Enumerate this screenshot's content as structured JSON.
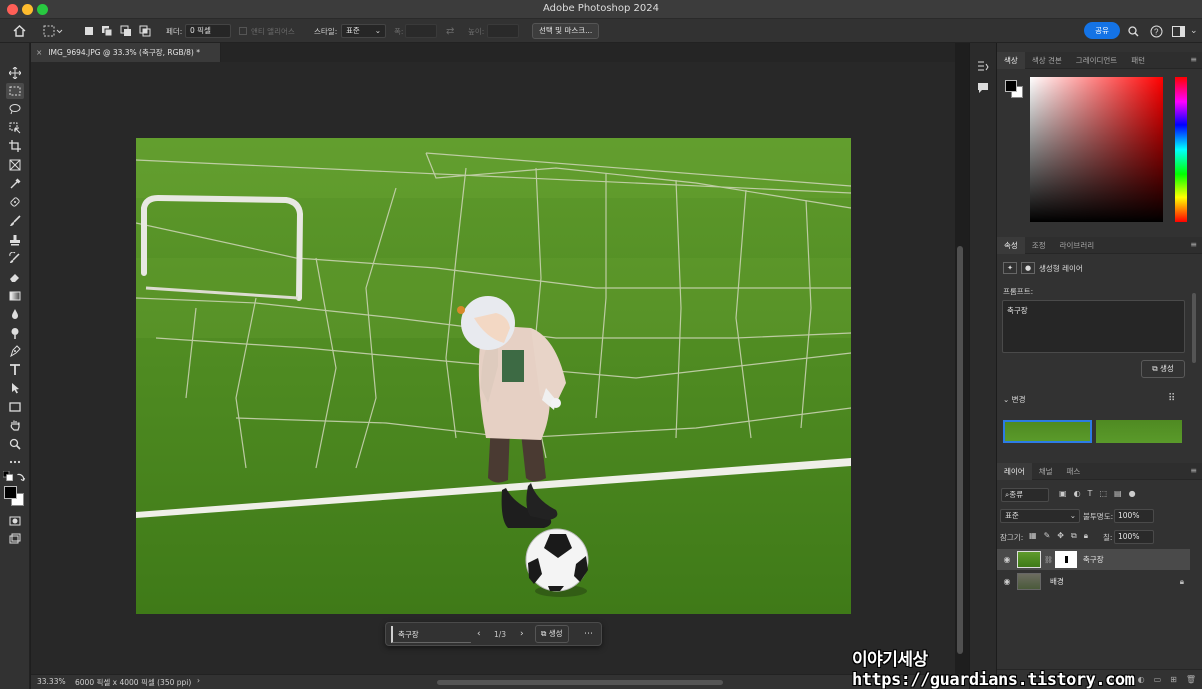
{
  "app": {
    "title": "Adobe Photoshop 2024"
  },
  "options": {
    "feather_label": "페더:",
    "feather_value": "0 픽셀",
    "antialias_label": "앤티 앨리어스",
    "style_label": "스타일:",
    "style_value": "표준",
    "width_label": "폭:",
    "height_label": "높이:",
    "select_mask_label": "선택 및 마스크...",
    "share_label": "공유"
  },
  "document": {
    "tab_title": "IMG_9694.JPG @ 33.3% (축구장, RGB/8) *",
    "zoom": "33.33%",
    "info": "6000 픽셀 x 4000 픽셀 (350 ppi)"
  },
  "contextual_bar": {
    "prompt": "축구장",
    "counter": "1/3",
    "generate_label": "생성"
  },
  "color_panel": {
    "tabs": [
      "색상",
      "색상 견본",
      "그레이디언트",
      "패턴"
    ],
    "foreground": "#000000",
    "background": "#ffffff"
  },
  "properties_panel": {
    "tabs": [
      "속성",
      "조정",
      "라이브러리"
    ],
    "layer_type": "생성형 레이어",
    "prompt_label": "프롬프트:",
    "prompt_value": "축구장",
    "generate_label": "생성",
    "variations_label": "변경"
  },
  "layers_panel": {
    "tabs": [
      "레이어",
      "채널",
      "패스"
    ],
    "filter_label": "종류",
    "blend_mode": "표준",
    "opacity_label": "불투명도:",
    "opacity_value": "100%",
    "lock_label": "잠그기:",
    "fill_label": "칠:",
    "fill_value": "100%",
    "layers": [
      {
        "name": "축구장",
        "selected": true
      },
      {
        "name": "배경",
        "selected": false
      }
    ]
  },
  "watermark": "이야기세상 https://guardians.tistory.com",
  "colors": {
    "accent": "#1473e6",
    "selection": "#2c7be5"
  }
}
